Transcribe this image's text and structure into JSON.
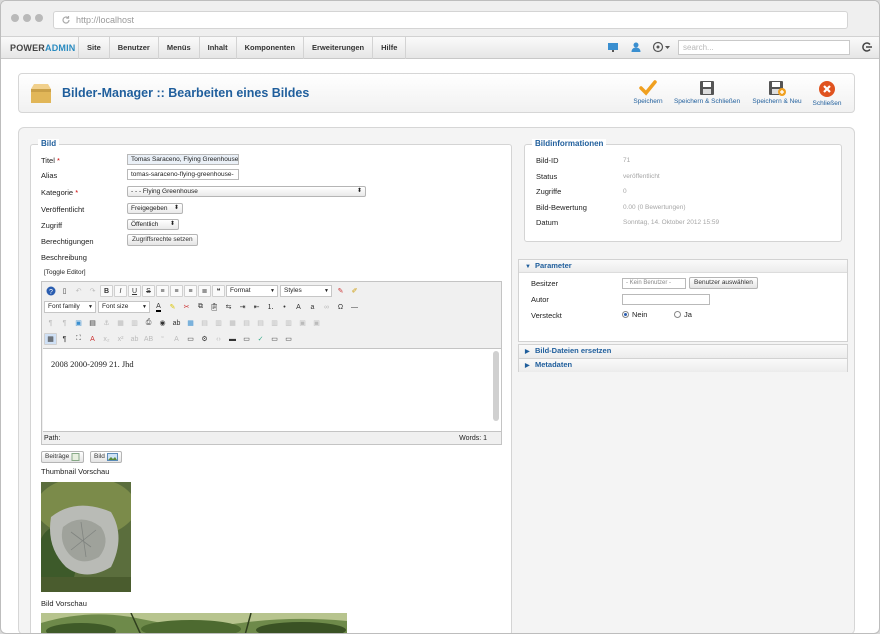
{
  "browser": {
    "url": "http://localhost"
  },
  "adminbar": {
    "brand_a": "POWER",
    "brand_b": "ADMIN",
    "menu": [
      "Site",
      "Benutzer",
      "Menüs",
      "Inhalt",
      "Komponenten",
      "Erweiterungen",
      "Hilfe"
    ],
    "search_placeholder": "search..."
  },
  "toolbar": {
    "title": "Bilder-Manager :: Bearbeiten eines Bildes",
    "buttons": [
      {
        "label": "Speichern",
        "icon": "checkmark-icon"
      },
      {
        "label": "Speichern & Schließen",
        "icon": "floppy-icon"
      },
      {
        "label": "Speichern & Neu",
        "icon": "floppy-plus-icon"
      },
      {
        "label": "Schließen",
        "icon": "close-icon"
      }
    ]
  },
  "bild": {
    "legend": "Bild",
    "title_label": "Titel",
    "title_value": "Tomas Saraceno, Flying Greenhouse",
    "alias_label": "Alias",
    "alias_value": "tomas-saraceno-flying-greenhouse-",
    "kategorie_label": "Kategorie",
    "kategorie_value": "- - - Flying Greenhouse",
    "veroeff_label": "Veröffentlicht",
    "veroeff_value": "Freigegeben",
    "zugriff_label": "Zugriff",
    "zugriff_value": "Öffentlich",
    "berecht_label": "Berechtigungen",
    "berecht_button": "Zugriffsrechte setzen",
    "beschreibung_label": "Beschreibung",
    "toggle_editor": "[Toggle Editor]",
    "font_family": "Font family",
    "font_size": "Font size",
    "format": "Format",
    "styles": "Styles",
    "content_text": "2008 2000-2099 21. Jhd",
    "path_label": "Path:",
    "words_label": "Words: 1",
    "btn_beitraege": "Beiträge",
    "btn_bild": "Bild",
    "thumb_label": "Thumbnail Vorschau",
    "bild_vorschau_label": "Bild Vorschau"
  },
  "info": {
    "legend": "Bildinformationen",
    "rows": [
      {
        "label": "Bild-ID",
        "value": "71"
      },
      {
        "label": "Status",
        "value": "veröffentlicht"
      },
      {
        "label": "Zugriffe",
        "value": "0"
      },
      {
        "label": "Bild-Bewertung",
        "value": "0.00 (0 Bewertungen)"
      },
      {
        "label": "Datum",
        "value": "Sonntag, 14. Oktober 2012 15:59"
      }
    ]
  },
  "parameter": {
    "title": "Parameter",
    "besitzer_label": "Besitzer",
    "besitzer_value": "- Kein Benutzer -",
    "besitzer_button": "Benutzer auswählen",
    "autor_label": "Autor",
    "autor_value": "",
    "versteckt_label": "Versteckt",
    "nein": "Nein",
    "ja": "Ja"
  },
  "panels": {
    "dateien": "Bild-Dateien ersetzen",
    "metadaten": "Metadaten"
  }
}
